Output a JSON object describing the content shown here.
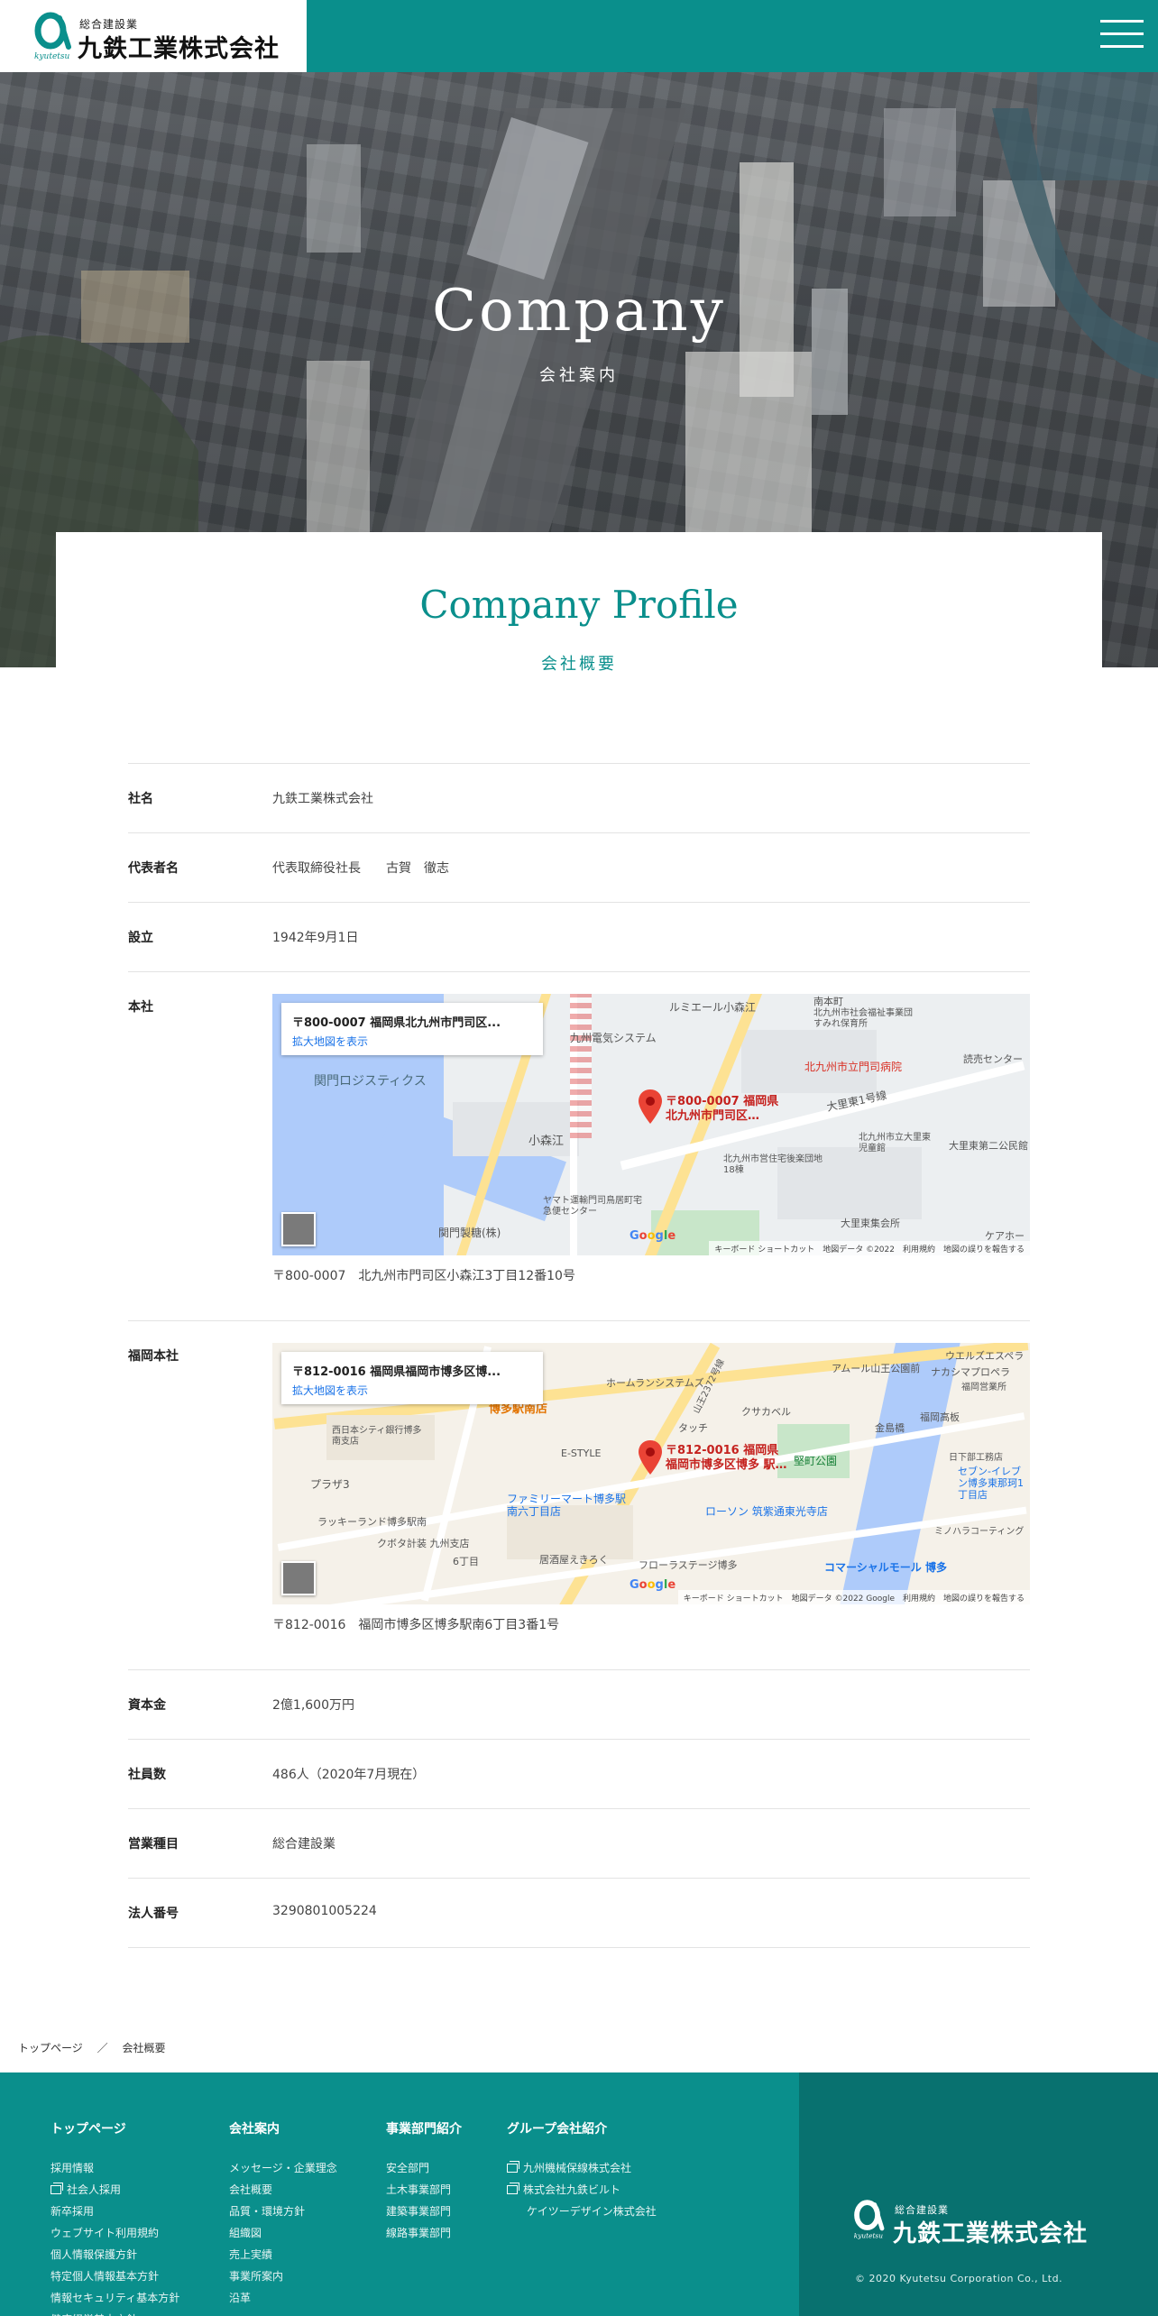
{
  "header": {
    "logo_small": "総合建設業",
    "logo_name": "九鉄工業株式会社",
    "logo_mark_text": "kyutetsu"
  },
  "hero": {
    "title": "Company",
    "subtitle": "会社案内"
  },
  "section": {
    "title": "Company Profile",
    "subtitle": "会社概要"
  },
  "profile": {
    "rows": [
      {
        "label": "社名",
        "value": "九鉄工業株式会社"
      },
      {
        "label": "代表者名",
        "value": "代表取締役社長　　古賀　徹志"
      },
      {
        "label": "設立",
        "value": "1942年9月1日"
      }
    ],
    "head_office": {
      "label": "本社",
      "map_card_title": "〒800-0007 福岡県北九州市門司区...",
      "map_card_link": "拡大地図を表示",
      "pin_label_1": "〒800-0007 福岡県",
      "pin_label_2": "北九州市門司区…",
      "map_labels": [
        "ルミエール小森江",
        "九州電気システム",
        "北九州市社会福祉事業団すみれ保育所",
        "北九州市立門司病院",
        "読売センター",
        "関門ロジスティクス",
        "小森江",
        "大里東1号線",
        "北九州市立大里東児童館",
        "北九州市営住宅後楽団地18棟",
        "大里東第二公民館",
        "関門製糖(株)",
        "ヤマト運輸門司鳥居町宅急便センター",
        "大里東集会所",
        "南本町",
        "ケアホー"
      ],
      "map_footer": "キーボード ショートカット　地図データ ©2022　利用規約　地図の誤りを報告する",
      "address": "〒800-0007　北九州市門司区小森江3丁目12番10号"
    },
    "fukuoka_office": {
      "label": "福岡本社",
      "map_card_title": "〒812-0016 福岡県福岡市博多区博...",
      "map_card_link": "拡大地図を表示",
      "pin_label_1": "〒812-0016 福岡県",
      "pin_label_2": "福岡市博多区博多 駅…",
      "map_labels": [
        "ホームランシステムズ",
        "アムール山王公園前",
        "ウエルズエスペラ",
        "ナカシマプロペラ",
        "福岡営業所",
        "博多駅南店",
        "西日本シティ銀行博多南支店",
        "クサカベル",
        "タッチ",
        "金島橋",
        "福岡高板",
        "日下部工務店",
        "E-STYLE",
        "堅町公園",
        "セブン-イレブン博多東那珂1丁目店",
        "プラザ3",
        "ファミリーマート博多駅南六丁目店",
        "ローソン 筑紫通東光寺店",
        "ミノハラコーティング",
        "ラッキーランド博多駅南",
        "クボタ計装 九州支店",
        "6丁目",
        "居酒屋えきろく",
        "フローラステージ博多",
        "コマーシャルモール 博多",
        "山王2372号線"
      ],
      "map_footer": "キーボード ショートカット　地図データ ©2022 Google　利用規約　地図の誤りを報告する",
      "address": "〒812-0016　福岡市博多区博多駅南6丁目3番1号"
    },
    "rows_after": [
      {
        "label": "資本金",
        "value": "2億1,600万円"
      },
      {
        "label": "社員数",
        "value": "486人（2020年7月現在）"
      },
      {
        "label": "営業種目",
        "value": "総合建設業"
      },
      {
        "label": "法人番号",
        "value": "3290801005224"
      }
    ]
  },
  "breadcrumb": {
    "home": "トップページ",
    "separator": "／",
    "current": "会社概要"
  },
  "footer": {
    "col1": {
      "heading": "トップページ",
      "items": [
        "採用情報",
        "社会人採用",
        "新卒採用",
        "ウェブサイト利用規約",
        "個人情報保護方針",
        "特定個人情報基本方針",
        "情報セキュリティ基本方針",
        "健康経営基本方針"
      ]
    },
    "col2": {
      "heading": "会社案内",
      "items": [
        "メッセージ・企業理念",
        "会社概要",
        "品質・環境方針",
        "組織図",
        "売上実績",
        "事業所案内",
        "沿革"
      ]
    },
    "col3": {
      "heading": "事業部門紹介",
      "items": [
        "安全部門",
        "土木事業部門",
        "建築事業部門",
        "線路事業部門"
      ]
    },
    "col4": {
      "heading": "グループ会社紹介",
      "items": [
        "九州機械保線株式会社",
        "株式会社九鉄ビルト",
        "ケイツーデザイン株式会社"
      ]
    },
    "logo_small": "総合建設業",
    "logo_name": "九鉄工業株式会社",
    "logo_mark_text": "kyutetsu",
    "copyright": "© 2020 Kyutetsu Corporation Co., Ltd."
  },
  "colors": {
    "brand": "#0a8f8c",
    "brand_dark": "#08716f",
    "pin": "#ea4335"
  }
}
